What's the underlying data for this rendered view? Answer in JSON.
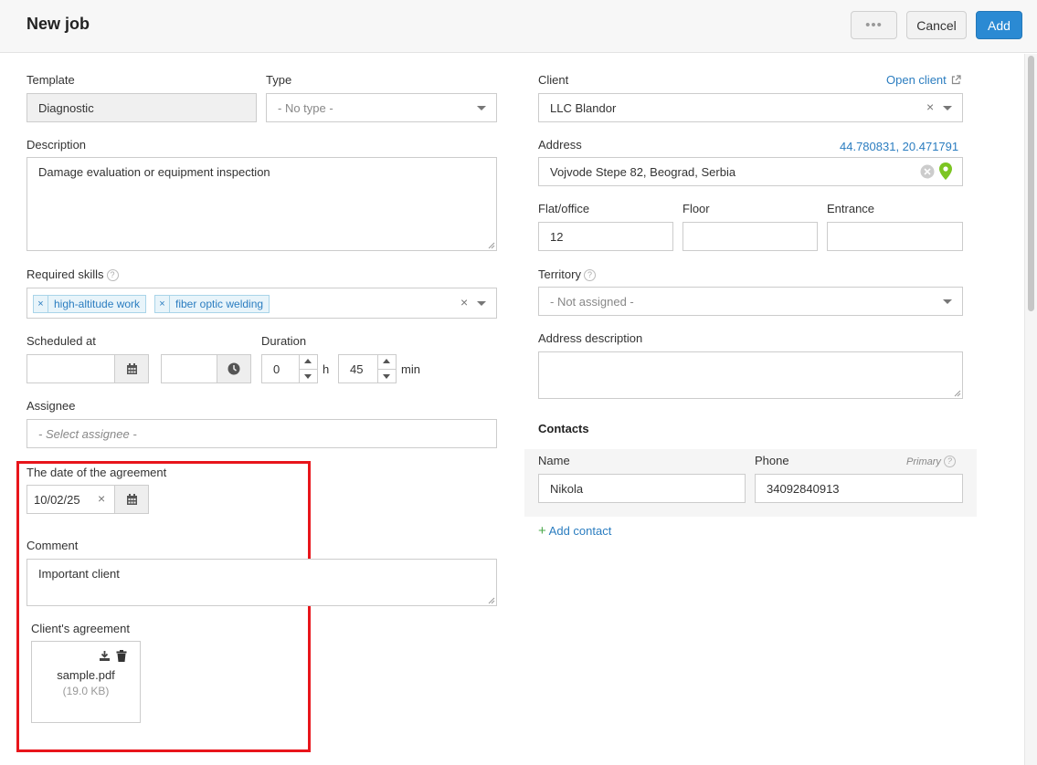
{
  "header": {
    "title": "New job",
    "more_label": "•••",
    "cancel_label": "Cancel",
    "add_label": "Add"
  },
  "left": {
    "template": {
      "label": "Template",
      "value": "Diagnostic"
    },
    "type": {
      "label": "Type",
      "value": "- No type -"
    },
    "description": {
      "label": "Description",
      "value": "Damage evaluation or equipment inspection"
    },
    "skills": {
      "label": "Required skills",
      "tags": [
        "high-altitude work",
        "fiber optic welding"
      ]
    },
    "scheduled": {
      "label": "Scheduled at",
      "date": "",
      "time": ""
    },
    "duration": {
      "label": "Duration",
      "hours": "0",
      "hours_unit": "h",
      "minutes": "45",
      "minutes_unit": "min"
    },
    "assignee": {
      "label": "Assignee",
      "placeholder": "- Select assignee -"
    },
    "agreement_date": {
      "label": "The date of the agreement",
      "value": "10/02/25"
    },
    "comment": {
      "label": "Comment",
      "value": "Important client"
    },
    "agreement_file": {
      "label": "Client's agreement",
      "file_name": "sample.pdf",
      "file_size": "(19.0 KB)"
    }
  },
  "right": {
    "client": {
      "label": "Client",
      "link": "Open client",
      "value": "LLC Blandor"
    },
    "address": {
      "label": "Address",
      "coords": "44.780831, 20.471791",
      "value": "Vojvode Stepe 82, Beograd, Serbia"
    },
    "flat": {
      "label": "Flat/office",
      "value": "12"
    },
    "floor": {
      "label": "Floor",
      "value": ""
    },
    "entrance": {
      "label": "Entrance",
      "value": ""
    },
    "territory": {
      "label": "Territory",
      "value": "- Not assigned -"
    },
    "address_description": {
      "label": "Address description",
      "value": ""
    },
    "contacts": {
      "heading": "Contacts",
      "name_label": "Name",
      "phone_label": "Phone",
      "primary_label": "Primary",
      "name": "Nikola",
      "phone": "34092840913",
      "add_label": "Add contact"
    }
  },
  "colors": {
    "accent": "#2b8ad3",
    "link": "#2b7dc0",
    "highlight": "#e8151b",
    "pin": "#7cc522"
  }
}
